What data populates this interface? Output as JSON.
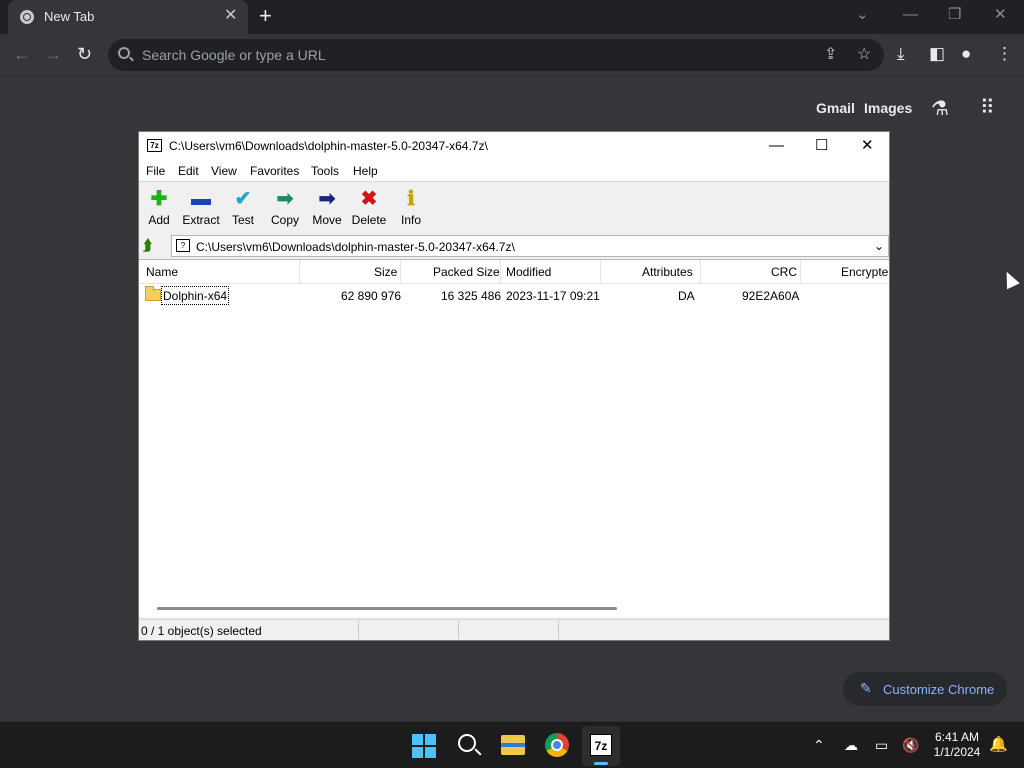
{
  "chrome": {
    "tab_title": "New Tab",
    "omnibox_placeholder": "Search Google or type a URL",
    "ntp_links": [
      "Gmail",
      "Images"
    ],
    "customize_label": "Customize Chrome"
  },
  "window": {
    "title": "C:\\Users\\vm6\\Downloads\\dolphin-master-5.0-20347-x64.7z\\",
    "app_icon_label": "7z",
    "menu": [
      "File",
      "Edit",
      "View",
      "Favorites",
      "Tools",
      "Help"
    ],
    "toolbar": [
      {
        "label": "Add",
        "icon": "plus-icon",
        "glyph": "✚",
        "color": "#19b219"
      },
      {
        "label": "Extract",
        "icon": "minus-icon",
        "glyph": "▬",
        "color": "#1f3fbf"
      },
      {
        "label": "Test",
        "icon": "check-icon",
        "glyph": "✔",
        "color": "#22aacc"
      },
      {
        "label": "Copy",
        "icon": "copy-arrow-icon",
        "glyph": "➡",
        "color": "#1b8a6b"
      },
      {
        "label": "Move",
        "icon": "move-arrow-icon",
        "glyph": "➡",
        "color": "#1a237e"
      },
      {
        "label": "Delete",
        "icon": "delete-x-icon",
        "glyph": "✖",
        "color": "#d01515"
      },
      {
        "label": "Info",
        "icon": "info-icon",
        "glyph": "ℹ",
        "color": "#c9a400"
      }
    ],
    "address": "C:\\Users\\vm6\\Downloads\\dolphin-master-5.0-20347-x64.7z\\",
    "columns": [
      "Name",
      "Size",
      "Packed Size",
      "Modified",
      "Attributes",
      "CRC",
      "Encrypte"
    ],
    "rows": [
      {
        "name": "Dolphin-x64",
        "size": "62 890 976",
        "packed": "16 325 486",
        "modified": "2023-11-17 09:21",
        "attributes": "DA",
        "crc": "92E2A60A",
        "encrypted": ""
      }
    ],
    "status": "0 / 1 object(s) selected"
  },
  "taskbar": {
    "sevenzip_label": "7z",
    "time": "6:41 AM",
    "date": "1/1/2024"
  }
}
